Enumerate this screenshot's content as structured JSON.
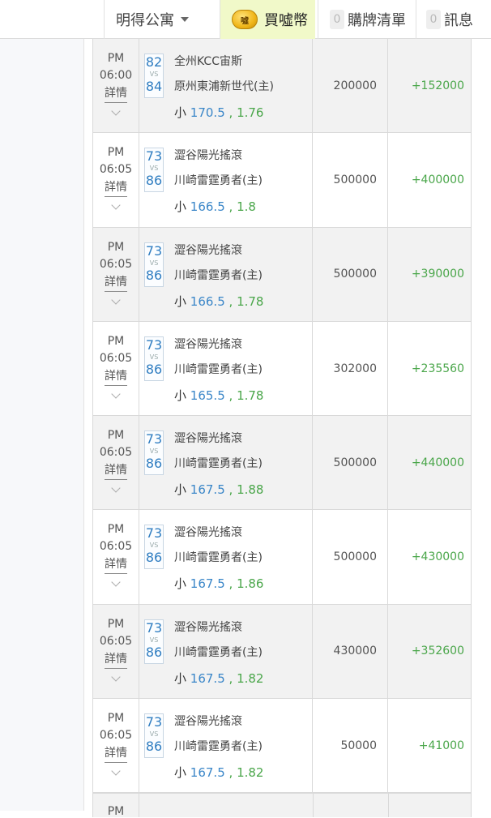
{
  "header": {
    "user_name": "明得公寓",
    "buy_label": "買噓幣",
    "coin_icon_text": "噓",
    "cart_count": "0",
    "cart_label": "購牌清單",
    "msg_count": "0",
    "msg_label": "訊息"
  },
  "table": {
    "detail_label": "詳情",
    "vs_label": "VS",
    "rows": [
      {
        "ampm": "PM",
        "time": "06:00",
        "score_a": "82",
        "score_b": "84",
        "team_a": "全州KCC宙斯",
        "team_b": "原州東浦新世代(主)",
        "bet_kind": "小",
        "bet_line": "170.5",
        "bet_odds": ", 1.76",
        "stake": "200000",
        "profit": "+152000"
      },
      {
        "ampm": "PM",
        "time": "06:05",
        "score_a": "73",
        "score_b": "86",
        "team_a": "澀谷陽光搖滾",
        "team_b": "川崎雷霆勇者(主)",
        "bet_kind": "小",
        "bet_line": "166.5",
        "bet_odds": ", 1.8",
        "stake": "500000",
        "profit": "+400000"
      },
      {
        "ampm": "PM",
        "time": "06:05",
        "score_a": "73",
        "score_b": "86",
        "team_a": "澀谷陽光搖滾",
        "team_b": "川崎雷霆勇者(主)",
        "bet_kind": "小",
        "bet_line": "166.5",
        "bet_odds": ", 1.78",
        "stake": "500000",
        "profit": "+390000"
      },
      {
        "ampm": "PM",
        "time": "06:05",
        "score_a": "73",
        "score_b": "86",
        "team_a": "澀谷陽光搖滾",
        "team_b": "川崎雷霆勇者(主)",
        "bet_kind": "小",
        "bet_line": "165.5",
        "bet_odds": ", 1.78",
        "stake": "302000",
        "profit": "+235560"
      },
      {
        "ampm": "PM",
        "time": "06:05",
        "score_a": "73",
        "score_b": "86",
        "team_a": "澀谷陽光搖滾",
        "team_b": "川崎雷霆勇者(主)",
        "bet_kind": "小",
        "bet_line": "167.5",
        "bet_odds": ", 1.88",
        "stake": "500000",
        "profit": "+440000"
      },
      {
        "ampm": "PM",
        "time": "06:05",
        "score_a": "73",
        "score_b": "86",
        "team_a": "澀谷陽光搖滾",
        "team_b": "川崎雷霆勇者(主)",
        "bet_kind": "小",
        "bet_line": "167.5",
        "bet_odds": ", 1.86",
        "stake": "500000",
        "profit": "+430000"
      },
      {
        "ampm": "PM",
        "time": "06:05",
        "score_a": "73",
        "score_b": "86",
        "team_a": "澀谷陽光搖滾",
        "team_b": "川崎雷霆勇者(主)",
        "bet_kind": "小",
        "bet_line": "167.5",
        "bet_odds": ", 1.82",
        "stake": "430000",
        "profit": "+352600"
      },
      {
        "ampm": "PM",
        "time": "06:05",
        "score_a": "73",
        "score_b": "86",
        "team_a": "澀谷陽光搖滾",
        "team_b": "川崎雷霆勇者(主)",
        "bet_kind": "小",
        "bet_line": "167.5",
        "bet_odds": ", 1.82",
        "stake": "50000",
        "profit": "+41000"
      }
    ],
    "partial_ampm": "PM"
  },
  "colors": {
    "accent_blue": "#2f7dc1",
    "profit_green": "#4aa64a",
    "buy_bg": "#f1f9c9"
  }
}
